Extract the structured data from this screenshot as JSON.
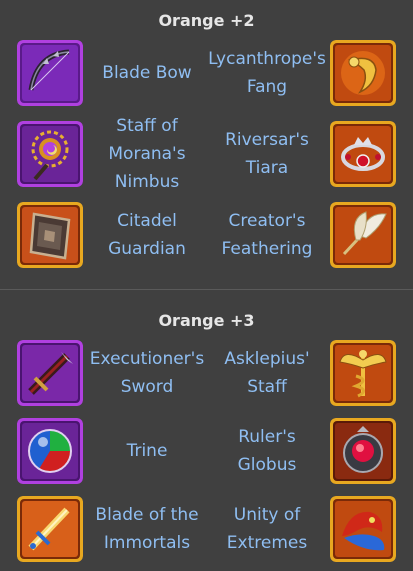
{
  "sections": [
    {
      "title": "Orange +2",
      "rows": [
        {
          "left": {
            "name": "Blade Bow",
            "icon": "blade-bow-icon"
          },
          "right": {
            "name": "Lycanthrope's Fang",
            "icon": "lycanthropes-fang-icon"
          }
        },
        {
          "left": {
            "name": "Staff of Morana's Nimbus",
            "icon": "staff-of-moranas-nimbus-icon"
          },
          "right": {
            "name": "Riversar's Tiara",
            "icon": "riversars-tiara-icon"
          }
        },
        {
          "left": {
            "name": "Citadel Guardian",
            "icon": "citadel-guardian-icon"
          },
          "right": {
            "name": "Creator's Feathering",
            "icon": "creators-feathering-icon"
          }
        }
      ]
    },
    {
      "title": "Orange +3",
      "rows": [
        {
          "left": {
            "name": "Executioner's Sword",
            "icon": "executioners-sword-icon"
          },
          "right": {
            "name": "Asklepius' Staff",
            "icon": "asklepius-staff-icon"
          }
        },
        {
          "left": {
            "name": "Trine",
            "icon": "trine-icon"
          },
          "right": {
            "name": "Ruler's Globus",
            "icon": "rulers-globus-icon"
          }
        },
        {
          "left": {
            "name": "Blade of the Immortals",
            "icon": "blade-of-the-immortals-icon"
          },
          "right": {
            "name": "Unity of Extremes",
            "icon": "unity-of-extremes-icon"
          }
        }
      ]
    }
  ],
  "colors": {
    "background": "#404040",
    "title": "#e6e6e6",
    "item_label": "#8fbef2",
    "purple_frame": "#a13bd1",
    "orange_frame": "#e0a020"
  }
}
